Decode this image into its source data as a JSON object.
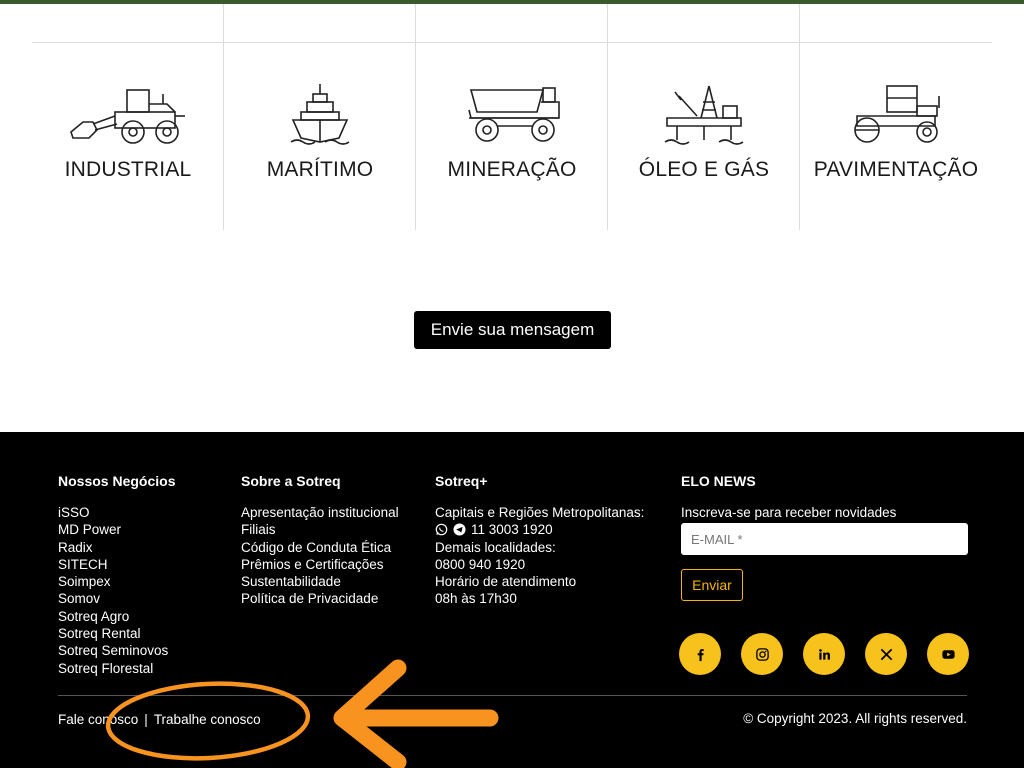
{
  "sectors": [
    {
      "label": "INDUSTRIAL",
      "icon": "wheel-loader-icon"
    },
    {
      "label": "MARÍTIMO",
      "icon": "ship-icon"
    },
    {
      "label": "MINERAÇÃO",
      "icon": "dump-truck-icon"
    },
    {
      "label": "ÓLEO E GÁS",
      "icon": "oil-rig-icon"
    },
    {
      "label": "PAVIMENTAÇÃO",
      "icon": "road-roller-icon"
    }
  ],
  "contact_button": "Envie sua mensagem",
  "footer": {
    "business": {
      "title": "Nossos Negócios",
      "items": [
        "iSSO",
        "MD Power",
        "Radix",
        "SITECH",
        "Soimpex",
        "Somov",
        "Sotreq Agro",
        "Sotreq Rental",
        "Sotreq Seminovos",
        "Sotreq Florestal"
      ]
    },
    "about": {
      "title": "Sobre a Sotreq",
      "items": [
        "Apresentação institucional",
        "Filiais",
        "Código de Conduta Ética",
        "Prêmios e Certificações",
        "Sustentabilidade",
        "Política de Privacidade"
      ]
    },
    "plus": {
      "title": "Sotreq+",
      "capitals_label": "Capitais e Regiões Metropolitanas:",
      "phone1": "11 3003 1920",
      "other_label": "Demais localidades:",
      "phone2": "0800 940 1920",
      "hours_label": "Horário de atendimento",
      "hours": "08h às 17h30"
    },
    "news": {
      "title": "ELO NEWS",
      "subtitle": "Inscreva-se para receber novidades",
      "email_placeholder": "E-MAIL *",
      "send_label": "Enviar"
    },
    "socials": [
      "facebook-icon",
      "instagram-icon",
      "linkedin-icon",
      "x-icon",
      "youtube-icon"
    ],
    "bottom": {
      "link1": "Fale conosco",
      "separator": "|",
      "link2": "Trabalhe conosco",
      "copyright": "© Copyright 2023. All rights reserved."
    }
  },
  "colors": {
    "top_bar": "#3b5a2c",
    "footer_bg": "#000000",
    "social_yellow": "#f7c21b",
    "accent": "#f5b400",
    "annotation": "#f7931e"
  }
}
